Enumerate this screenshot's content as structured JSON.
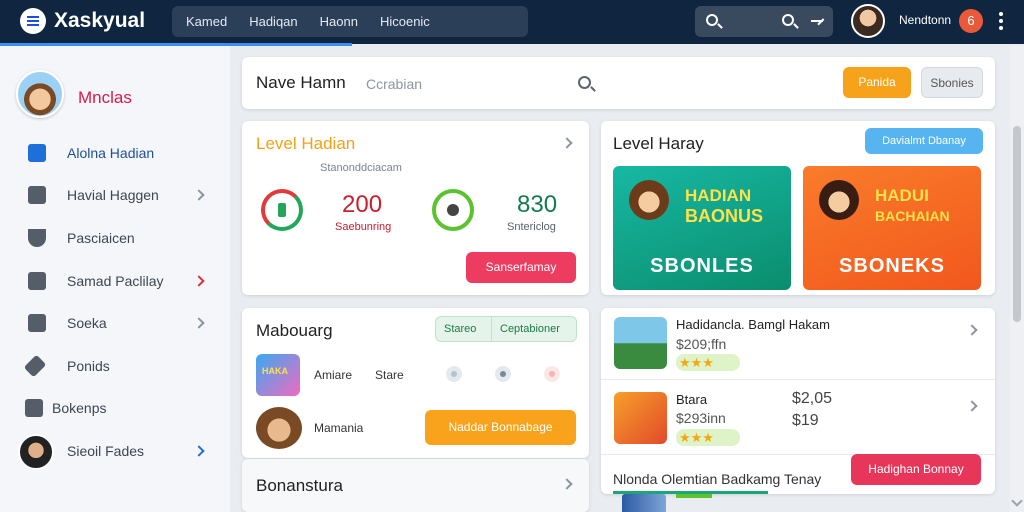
{
  "header": {
    "app_title": "Xaskyual",
    "nav": [
      "Kamed",
      "Hadiqan",
      "Haonn",
      "Hicoenic"
    ],
    "user_name": "Nendtonn",
    "notifications": "6"
  },
  "sidebar": {
    "profile_name": "Mnclas",
    "items": [
      {
        "label": "Alolna Hadian",
        "icon": "bookmark-icon"
      },
      {
        "label": "Havial Haggen",
        "icon": "users-icon"
      },
      {
        "label": "Pasciaicen",
        "icon": "shield-icon"
      },
      {
        "label": "Samad Paclilay",
        "icon": "grid-icon"
      },
      {
        "label": "Soeka",
        "icon": "calendar-icon"
      },
      {
        "label": "Ponids",
        "icon": "tag-icon"
      },
      {
        "label": "Bokenps",
        "icon": "gift-icon"
      },
      {
        "label": "Sieoil Fades",
        "icon": "avatar"
      }
    ]
  },
  "search": {
    "title": "Nave Hamn",
    "placeholder": "Ccrabian",
    "primary_btn": "Panida",
    "secondary_btn": "Sbonies"
  },
  "level": {
    "title": "Level Hadian",
    "subtitle": "Stanonddciacam",
    "stat1_value": "200",
    "stat1_label": "Saebunring",
    "stat2_value": "830",
    "stat2_label": "Sntericlog",
    "button": "Sanserfamay"
  },
  "harvest": {
    "title": "Level Haray",
    "button": "Davialmt Dbanay",
    "banner1_head1": "HADIAN",
    "banner1_head2": "BAONUS",
    "banner1_label": "SBONLES",
    "banner2_head1": "HADUI",
    "banner2_head2": "BACHAIAN",
    "banner2_label": "SBONEKS"
  },
  "mabouarg": {
    "title": "Mabouarg",
    "seg_a": "Stareo",
    "seg_b": "Ceptabioner",
    "thumb_text": "HAKA",
    "row1_a": "Amiare",
    "row1_b": "Stare",
    "row2": "Mamania",
    "button": "Naddar Bonnabage"
  },
  "bonanstura": {
    "title": "Bonanstura"
  },
  "list": {
    "item1_title": "Hadidancla. Bamgl Hakam",
    "item1_price": "$209;ffn",
    "item2_title": "Btara",
    "item2_price": "$293inn",
    "item2_val1": "$2,05",
    "item2_val2": "$19",
    "stars": "★★★",
    "footer_text": "Nlonda Olemtian Badkamg Tenay",
    "button": "Hadighan Bonnay"
  }
}
